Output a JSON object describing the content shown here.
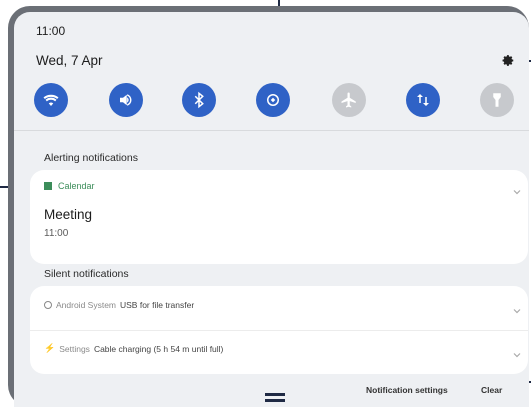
{
  "status": {
    "time": "11:00",
    "date": "Wed, 7 Apr"
  },
  "quick_settings": [
    {
      "name": "wifi-icon",
      "state": "on"
    },
    {
      "name": "sound-icon",
      "state": "on"
    },
    {
      "name": "bluetooth-icon",
      "state": "on"
    },
    {
      "name": "auto-rotate-icon",
      "state": "on"
    },
    {
      "name": "airplane-mode-icon",
      "state": "off"
    },
    {
      "name": "mobile-data-icon",
      "state": "on"
    },
    {
      "name": "flashlight-icon",
      "state": "off"
    }
  ],
  "alerting": {
    "section_label": "Alerting notifications",
    "app_name": "Calendar",
    "title": "Meeting",
    "time": "11:00"
  },
  "silent": {
    "section_label": "Silent notifications",
    "items": [
      {
        "app": "Android System",
        "text": "USB for file transfer"
      },
      {
        "app": "Settings",
        "text": "Cable charging (5 h 54 m until full)"
      }
    ]
  },
  "bottom": {
    "notification_settings": "Notification settings",
    "clear": "Clear"
  },
  "colors": {
    "accent": "#2f62c6",
    "inactive": "#c7c9cd",
    "calendar_green": "#3c8d5a",
    "callout": "#1f2a44"
  }
}
